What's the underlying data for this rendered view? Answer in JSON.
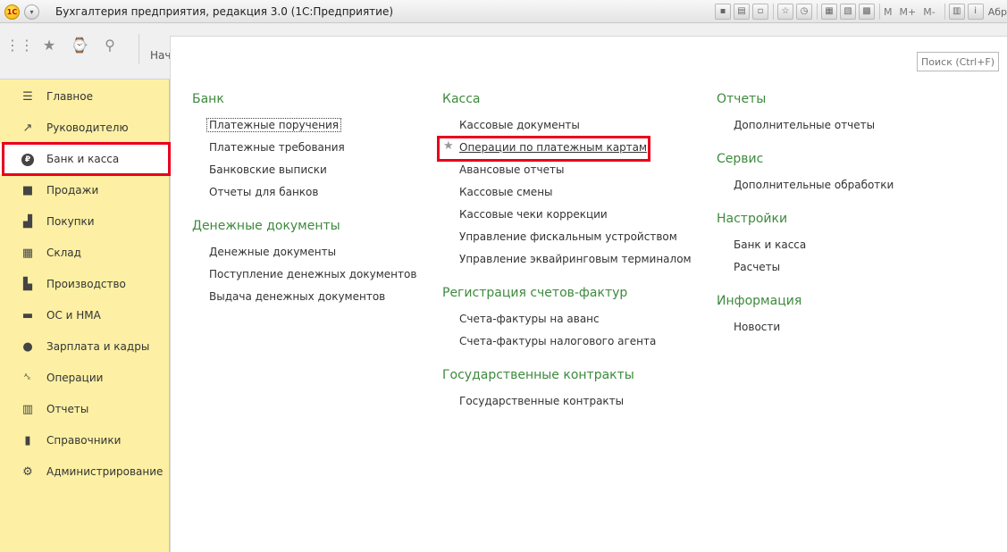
{
  "window": {
    "title": "Бухгалтерия предприятия, редакция 3.0  (1С:Предприятие)",
    "logo": "1С",
    "memory_buttons": [
      "M",
      "M+",
      "M-"
    ],
    "user": "Абрам"
  },
  "toolbar": {
    "start_tab": "Нач"
  },
  "search": {
    "placeholder": "Поиск (Ctrl+F)"
  },
  "sidebar": {
    "items": [
      {
        "label": "Главное",
        "icon": "menu-icon"
      },
      {
        "label": "Руководителю",
        "icon": "trend-icon"
      },
      {
        "label": "Банк и касса",
        "icon": "ruble-icon"
      },
      {
        "label": "Продажи",
        "icon": "bag-icon"
      },
      {
        "label": "Покупки",
        "icon": "cart-icon"
      },
      {
        "label": "Склад",
        "icon": "warehouse-icon"
      },
      {
        "label": "Производство",
        "icon": "factory-icon"
      },
      {
        "label": "ОС и НМА",
        "icon": "truck-icon"
      },
      {
        "label": "Зарплата и кадры",
        "icon": "person-icon"
      },
      {
        "label": "Операции",
        "icon": "dt-kt-icon"
      },
      {
        "label": "Отчеты",
        "icon": "bar-chart-icon"
      },
      {
        "label": "Справочники",
        "icon": "books-icon"
      },
      {
        "label": "Администрирование",
        "icon": "gear-icon"
      }
    ]
  },
  "sections": {
    "bank": {
      "title": "Банк",
      "links": [
        "Платежные поручения",
        "Платежные требования",
        "Банковские выписки",
        "Отчеты для банков"
      ]
    },
    "money_docs": {
      "title": "Денежные документы",
      "links": [
        "Денежные документы",
        "Поступление денежных документов",
        "Выдача денежных документов"
      ]
    },
    "cash": {
      "title": "Касса",
      "links": [
        "Кассовые документы",
        "Операции по платежным картам",
        "Авансовые отчеты",
        "Кассовые смены",
        "Кассовые чеки коррекции",
        "Управление фискальным устройством",
        "Управление эквайринговым терминалом"
      ]
    },
    "invoices": {
      "title": "Регистрация счетов-фактур",
      "links": [
        "Счета-фактуры на аванс",
        "Счета-фактуры налогового агента"
      ]
    },
    "contracts": {
      "title": "Государственные контракты",
      "links": [
        "Государственные контракты"
      ]
    },
    "reports": {
      "title": "Отчеты",
      "links": [
        "Дополнительные отчеты"
      ]
    },
    "service": {
      "title": "Сервис",
      "links": [
        "Дополнительные обработки"
      ]
    },
    "settings": {
      "title": "Настройки",
      "links": [
        "Банк и касса",
        "Расчеты"
      ]
    },
    "info": {
      "title": "Информация",
      "links": [
        "Новости"
      ]
    }
  }
}
